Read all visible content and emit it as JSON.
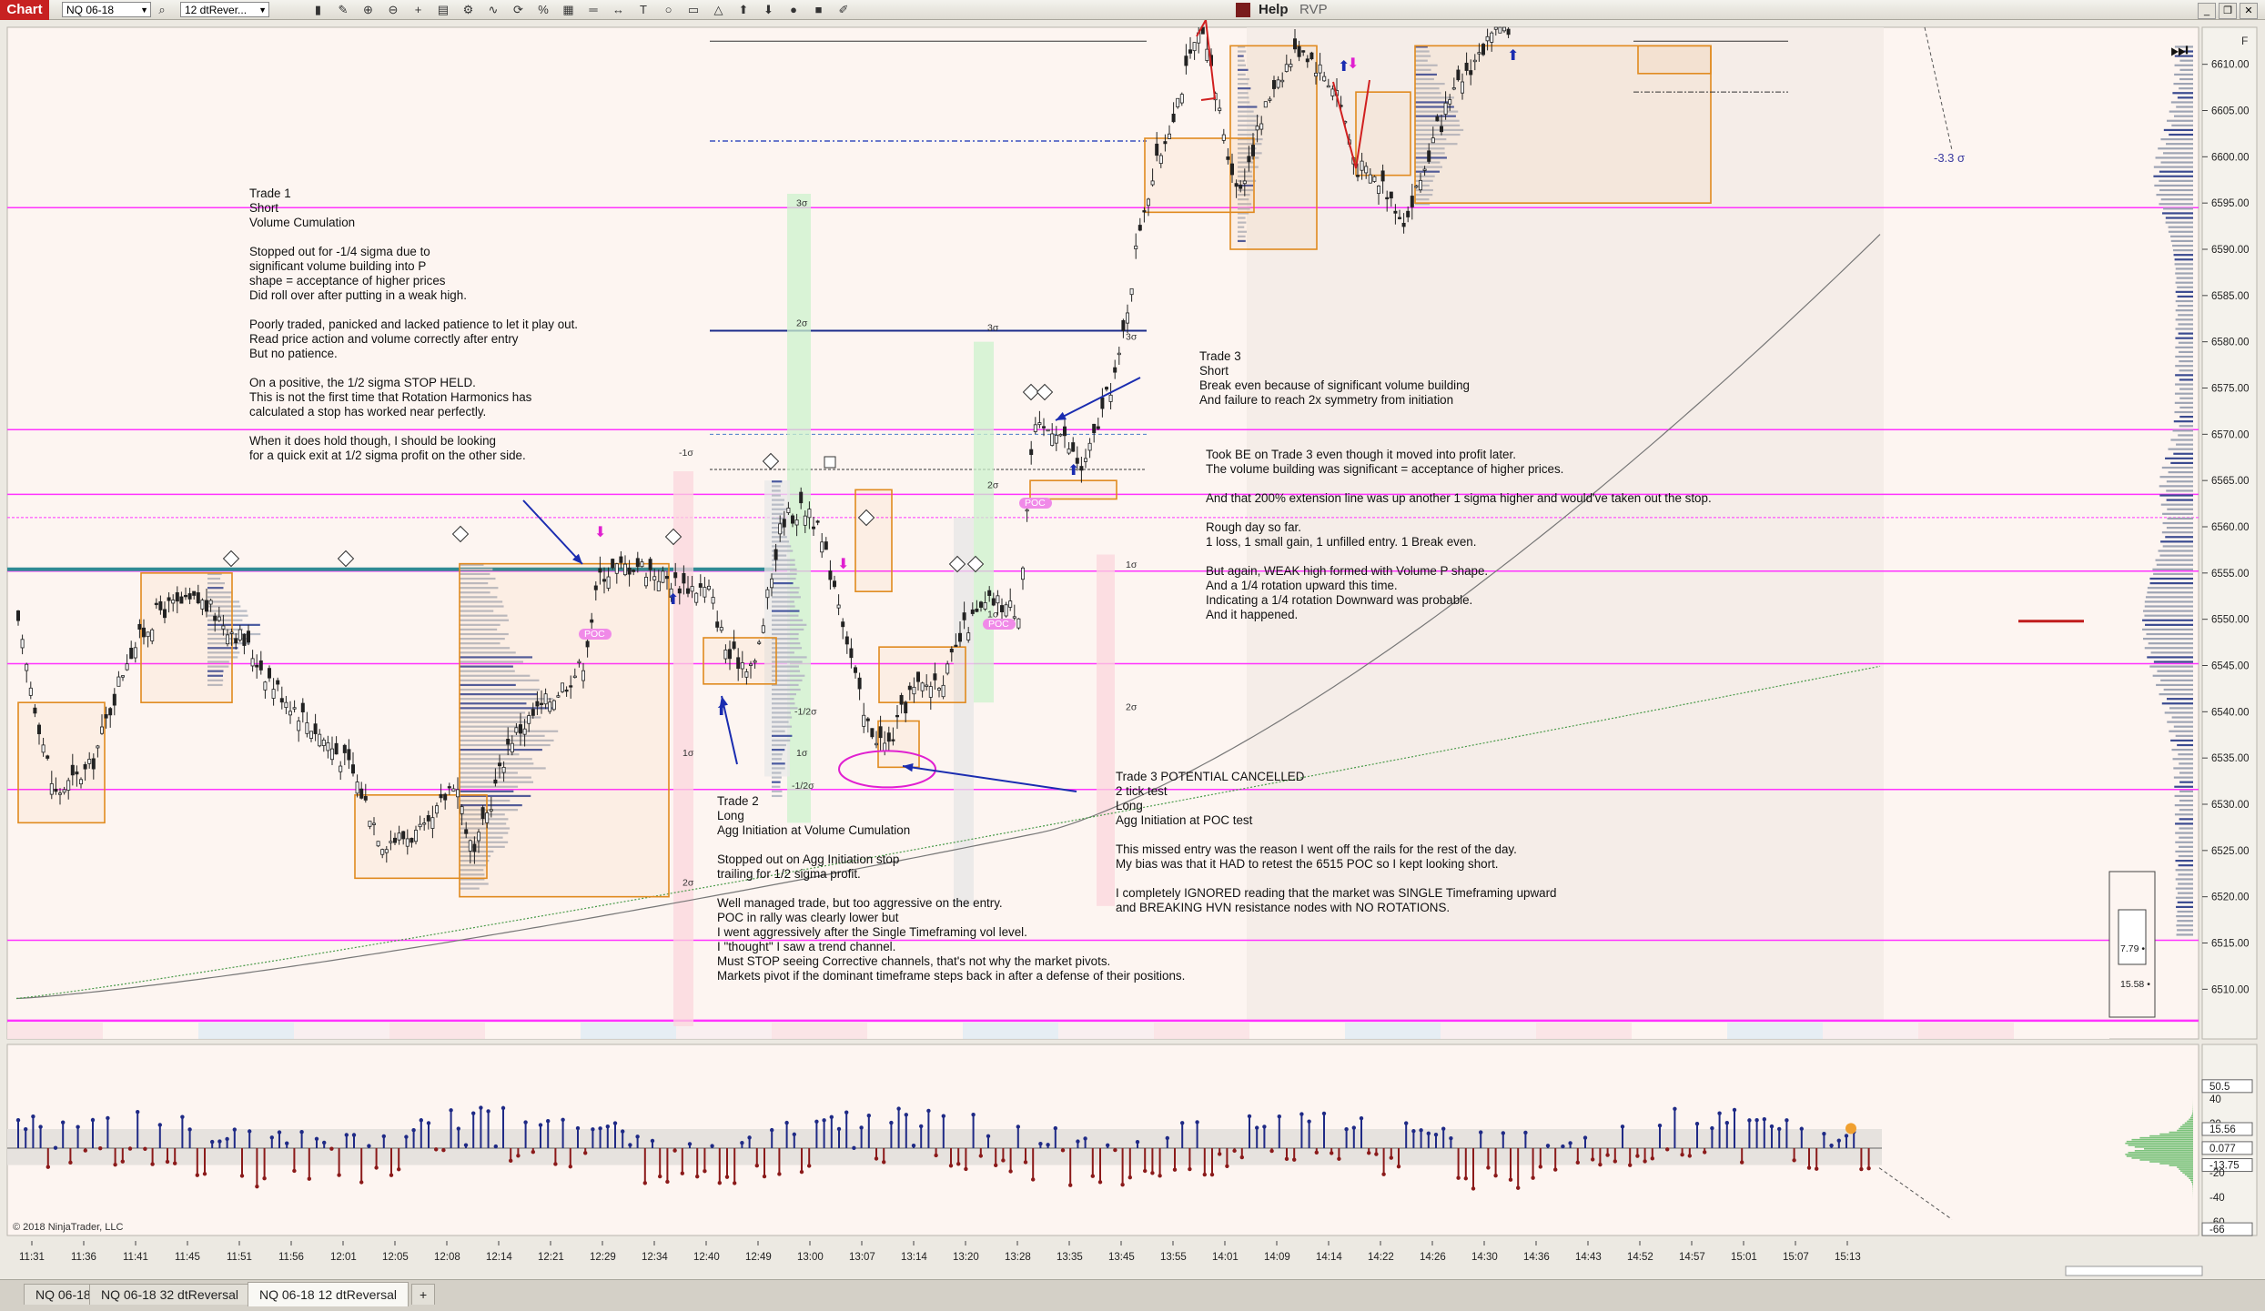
{
  "app": {
    "badge": "Chart"
  },
  "toolbar": {
    "instrument": "NQ 06-18",
    "bar_type": "12 dtRever...",
    "help_label": "Help",
    "rvp_label": "RVP",
    "icons": [
      "search-icon",
      "bars-icon",
      "pencil-icon",
      "zoom-in-icon",
      "zoom-out-icon",
      "crosshair-icon",
      "data-box-icon",
      "strategies-icon",
      "indicators-icon",
      "refresh-icon",
      "percent-icon",
      "properties-icon",
      "lines-icon",
      "arrow-icon",
      "text-icon",
      "ellipse-icon",
      "rectangle-icon",
      "triangle-icon",
      "arrow-up-icon",
      "arrow-down-icon",
      "dot-icon",
      "square-icon",
      "draw-more-icon"
    ]
  },
  "window": {
    "controls": [
      "_",
      "❐",
      "✕"
    ],
    "side_label": "F"
  },
  "tabs": [
    {
      "label": "NQ 06-18",
      "active": false
    },
    {
      "label": "NQ 06-18 32 dtReversal",
      "active": false
    },
    {
      "label": "NQ 06-18 12 dtReversal",
      "active": true
    }
  ],
  "add_tab": "+",
  "copyright": "© 2018 NinjaTrader, LLC",
  "price_axis": {
    "labels": [
      "6610.00",
      "6605.00",
      "6600.00",
      "6595.00",
      "6590.00",
      "6585.00",
      "6580.00",
      "6575.00",
      "6570.00",
      "6565.00",
      "6560.00",
      "6555.00",
      "6550.00",
      "6545.00",
      "6540.00",
      "6535.00",
      "6530.00",
      "6525.00",
      "6520.00",
      "6515.00",
      "6510.00"
    ],
    "min": 6506,
    "max": 6614
  },
  "time_axis": {
    "labels": [
      "11:31",
      "11:36",
      "11:41",
      "11:45",
      "11:51",
      "11:56",
      "12:01",
      "12:05",
      "12:08",
      "12:14",
      "12:21",
      "12:29",
      "12:34",
      "12:40",
      "12:49",
      "13:00",
      "13:07",
      "13:14",
      "13:20",
      "13:28",
      "13:35",
      "13:45",
      "13:55",
      "14:01",
      "14:09",
      "14:14",
      "14:22",
      "14:26",
      "14:30",
      "14:36",
      "14:43",
      "14:52",
      "14:57",
      "15:01",
      "15:07",
      "15:13"
    ]
  },
  "oscillator_axis": {
    "labels": [
      "50.5",
      "40",
      "20",
      "15.56",
      "0.077",
      "-13.75",
      "-20",
      "-40",
      "-60",
      "-66"
    ]
  },
  "sigma_label": "-3.3 σ",
  "level_labels": [
    "3σ",
    "2σ",
    "1σ",
    "-1σ",
    "-1/2σ",
    "-1/2σ",
    "3σ",
    "2σ",
    "1σ",
    "1σ",
    "2σ",
    "1σ",
    "2σ",
    "3σ"
  ],
  "poc_labels": [
    "POC",
    "POC",
    "POC"
  ],
  "side_panel_values": [
    "7.79 •",
    "15.58 •"
  ],
  "annotations": {
    "trade1": [
      "Trade 1",
      "Short",
      "Volume Cumulation",
      "",
      "Stopped out for -1/4 sigma due to",
      "significant volume building into P",
      "shape = acceptance of higher prices",
      "Did roll over after putting in a weak high.",
      "",
      "Poorly traded, panicked and lacked patience to let it play out.",
      "Read price action and volume correctly after entry",
      "But no patience.",
      "",
      "On a positive, the 1/2 sigma STOP HELD.",
      "This is not the first time that Rotation Harmonics has",
      "calculated a stop has worked near perfectly.",
      "",
      "When it does hold though, I should be looking",
      "for a quick exit at 1/2 sigma profit on the other side."
    ],
    "trade2": [
      "Trade 2",
      "Long",
      "Agg Initiation at Volume Cumulation",
      "",
      "Stopped out on Agg Initiation stop",
      "trailing for 1/2 sigma profit.",
      "",
      "Well managed trade, but too aggressive on the entry.",
      "POC in rally was clearly lower but",
      "I went aggressively after the Single Timeframing vol level.",
      "I \"thought\" I saw a trend channel.",
      "Must STOP seeing Corrective channels, that's not why the market pivots.",
      "Markets pivot if the dominant timeframe steps back in after a defense of their positions."
    ],
    "trade3": [
      "Trade 3",
      "Short",
      "Break even because of significant volume building",
      "And failure to reach 2x symmetry from initiation"
    ],
    "trade3_be": [
      "Took BE on Trade 3 even though it moved into profit later.",
      "The volume building was significant = acceptance of higher prices.",
      "",
      "And that 200% extension line was up another 1 sigma higher and would've taken out the stop.",
      "",
      "Rough day so far.",
      "1 loss, 1 small gain, 1 unfilled entry. 1 Break even.",
      "",
      "But again, WEAK high formed with Volume P shape.",
      "And a 1/4 rotation upward this time.",
      "Indicating a 1/4 rotation Downward was probable.",
      "And it happened."
    ],
    "trade3_potential": [
      "Trade 3 POTENTIAL CANCELLED",
      "2 tick test",
      "Long",
      "Agg Initiation at POC test",
      "",
      "This missed entry was the reason I went off the rails for the rest of the day.",
      "My bias was that it HAD to retest the 6515 POC so I kept looking short.",
      "",
      "I completely IGNORED reading that the market was SINGLE Timeframing upward",
      "and BREAKING HVN resistance nodes with NO ROTATIONS."
    ]
  },
  "colors": {
    "background": "#fdf5f1",
    "magenta_level": "#ff33ff",
    "teal_level": "#2f8a94",
    "navy_level": "#1c2c8a",
    "up_bar": "#1f2a86",
    "down_bar": "#8b1a1a",
    "box": "#e08a1e",
    "profile": "#5a6a8a",
    "green_vol": "#7ac27a"
  }
}
